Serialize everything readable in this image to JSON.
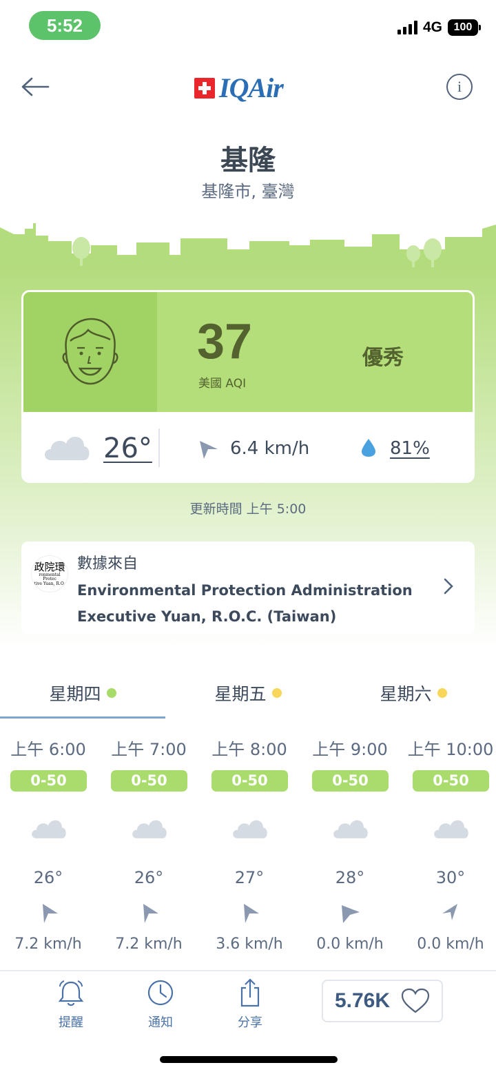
{
  "status_bar": {
    "time": "5:52",
    "network": "4G",
    "battery": "100"
  },
  "header": {
    "brand": "IQAir",
    "back_icon": "arrow-left-icon",
    "info_icon": "info-icon"
  },
  "location": {
    "city": "基隆",
    "region": "基隆市, 臺灣"
  },
  "aqi": {
    "value": "37",
    "label": "美國 AQI",
    "status": "優秀",
    "color": "#b3de7a",
    "face_color": "#a1d264"
  },
  "current_weather": {
    "icon": "cloud-icon",
    "temperature": "26°",
    "wind_speed": "6.4 km/h",
    "humidity": "81%"
  },
  "updated": "更新時間 上午 5:00",
  "source": {
    "from_label": "數據來自",
    "logo_text": "政院環",
    "logo_small_1": "ronmental Protec",
    "logo_small_2": "tive Yuan, R.O.",
    "name_line1": "Environmental Protection Administration",
    "name_line2": "Executive Yuan, R.O.C. (Taiwan)"
  },
  "day_tabs": [
    {
      "label": "星期四",
      "dot_color": "#a8db6a",
      "active": true
    },
    {
      "label": "星期五",
      "dot_color": "#f7d65a",
      "active": false
    },
    {
      "label": "星期六",
      "dot_color": "#f7d65a",
      "active": false
    }
  ],
  "hourly": [
    {
      "time": "上午 6:00",
      "aqi_range": "0-50",
      "temp": "26°",
      "wind": "7.2 km/h"
    },
    {
      "time": "上午 7:00",
      "aqi_range": "0-50",
      "temp": "26°",
      "wind": "7.2 km/h"
    },
    {
      "time": "上午 8:00",
      "aqi_range": "0-50",
      "temp": "27°",
      "wind": "3.6 km/h"
    },
    {
      "time": "上午 9:00",
      "aqi_range": "0-50",
      "temp": "28°",
      "wind": "0.0 km/h"
    },
    {
      "time": "上午 10:00",
      "aqi_range": "0-50",
      "temp": "30°",
      "wind": "0.0 km/h"
    }
  ],
  "bottom_nav": {
    "alert_label": "提醒",
    "notify_label": "通知",
    "share_label": "分享",
    "likes": "5.76K"
  }
}
